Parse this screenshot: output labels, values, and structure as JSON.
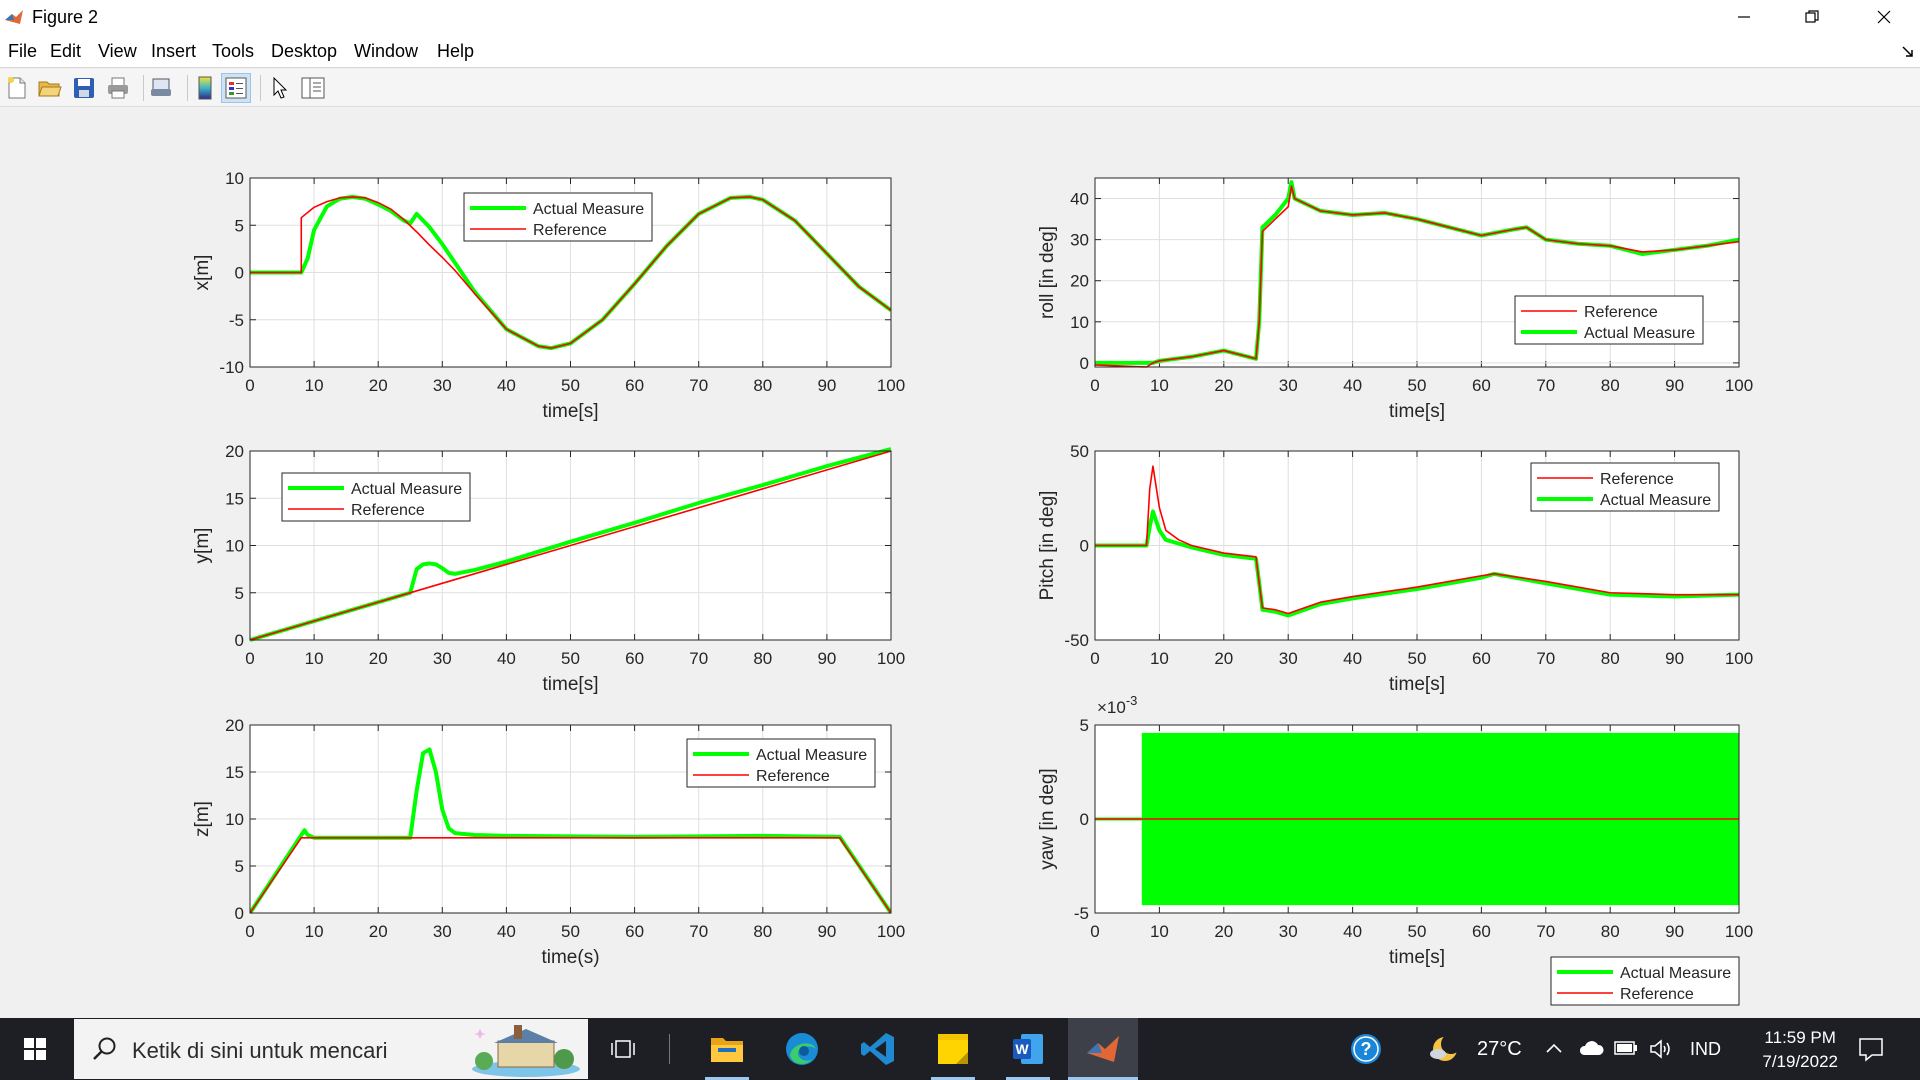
{
  "window": {
    "title": "Figure 2"
  },
  "menu": [
    "File",
    "Edit",
    "View",
    "Insert",
    "Tools",
    "Desktop",
    "Window",
    "Help"
  ],
  "toolbar_icons": [
    "new-figure-icon",
    "open-file-icon",
    "save-icon",
    "print-icon",
    "link-plot-icon",
    "insert-colorbar-icon",
    "insert-legend-icon",
    "edit-plot-icon",
    "property-inspector-icon"
  ],
  "colors": {
    "actual": "#00ff00",
    "reference": "#ff0000",
    "taskbar": "#1d1f24"
  },
  "chart_data": [
    {
      "id": "x",
      "type": "line",
      "xlabel": "time[s]",
      "ylabel": "x[m]",
      "xlim": [
        0,
        100
      ],
      "ylim": [
        -10,
        10
      ],
      "yticks": [
        -10,
        -5,
        0,
        5,
        10
      ],
      "grid": true,
      "legend": {
        "position": "top-center",
        "entries": [
          "Actual Measure",
          "Reference"
        ]
      },
      "series": [
        {
          "name": "Actual Measure",
          "x": [
            0,
            8,
            9,
            10,
            12,
            14,
            16,
            18,
            20,
            22,
            24,
            25,
            26,
            27,
            28,
            30,
            32,
            35,
            40,
            45,
            47,
            50,
            55,
            60,
            65,
            70,
            75,
            78,
            80,
            85,
            90,
            95,
            100
          ],
          "y": [
            0,
            0,
            1.5,
            4.5,
            7,
            7.8,
            8,
            7.8,
            7.2,
            6.5,
            5.5,
            5.2,
            6.2,
            5.5,
            4.8,
            3,
            1,
            -2,
            -6,
            -7.8,
            -8,
            -7.5,
            -5,
            -1.2,
            2.8,
            6.2,
            7.9,
            8,
            7.7,
            5.5,
            2,
            -1.5,
            -4
          ]
        },
        {
          "name": "Reference",
          "x": [
            0,
            8,
            8,
            10,
            12,
            14,
            16,
            18,
            20,
            22,
            24,
            26,
            28,
            30,
            32,
            35,
            40,
            45,
            47,
            50,
            55,
            60,
            65,
            70,
            75,
            78,
            80,
            85,
            90,
            95,
            100
          ],
          "y": [
            0,
            0,
            5.8,
            6.9,
            7.5,
            7.9,
            8,
            7.9,
            7.4,
            6.7,
            5.6,
            4.3,
            2.9,
            1.6,
            0.2,
            -2.2,
            -6,
            -7.8,
            -8,
            -7.5,
            -5,
            -1.2,
            2.8,
            6.2,
            7.9,
            8,
            7.7,
            5.5,
            2,
            -1.5,
            -4
          ]
        }
      ]
    },
    {
      "id": "y",
      "type": "line",
      "xlabel": "time[s]",
      "ylabel": "y[m]",
      "xlim": [
        0,
        100
      ],
      "ylim": [
        0,
        20
      ],
      "yticks": [
        0,
        5,
        10,
        15,
        20
      ],
      "grid": true,
      "legend": {
        "position": "top-left",
        "entries": [
          "Actual Measure",
          "Reference"
        ]
      },
      "series": [
        {
          "name": "Actual Measure",
          "x": [
            0,
            10,
            20,
            25,
            26,
            27,
            28,
            29,
            30,
            31,
            32,
            35,
            40,
            50,
            60,
            70,
            80,
            90,
            100
          ],
          "y": [
            0,
            2,
            4,
            5,
            7.5,
            8,
            8.1,
            8,
            7.6,
            7.1,
            7,
            7.4,
            8.3,
            10.4,
            12.4,
            14.5,
            16.4,
            18.4,
            20.2
          ]
        },
        {
          "name": "Reference",
          "x": [
            0,
            100
          ],
          "y": [
            0,
            20
          ]
        }
      ]
    },
    {
      "id": "z",
      "type": "line",
      "xlabel": "time(s)",
      "ylabel": "z[m]",
      "xlim": [
        0,
        100
      ],
      "ylim": [
        0,
        20
      ],
      "yticks": [
        0,
        5,
        10,
        15,
        20
      ],
      "grid": true,
      "legend": {
        "position": "top-right",
        "entries": [
          "Actual Measure",
          "Reference"
        ]
      },
      "series": [
        {
          "name": "Actual Measure",
          "x": [
            0,
            8.5,
            9,
            10,
            25,
            26,
            27,
            28,
            29,
            30,
            31,
            32,
            35,
            40,
            60,
            80,
            92,
            100
          ],
          "y": [
            0,
            8.8,
            8.3,
            8,
            8,
            13,
            17,
            17.4,
            15,
            11,
            9,
            8.5,
            8.3,
            8.2,
            8.1,
            8.2,
            8.1,
            0
          ]
        },
        {
          "name": "Reference",
          "x": [
            0,
            8,
            92,
            100
          ],
          "y": [
            0,
            8,
            8,
            0
          ]
        }
      ]
    },
    {
      "id": "roll",
      "type": "line",
      "xlabel": "time[s]",
      "ylabel": "roll [in deg]",
      "xlim": [
        0,
        100
      ],
      "ylim": [
        -1,
        45
      ],
      "yticks": [
        0,
        10,
        20,
        30,
        40
      ],
      "grid": true,
      "legend": {
        "position": "bottom-right",
        "entries": [
          "Reference",
          "Actual Measure"
        ]
      },
      "series": [
        {
          "name": "Reference",
          "x": [
            0,
            8,
            9,
            10,
            15,
            20,
            25,
            25.5,
            26,
            28,
            30,
            30.5,
            31,
            35,
            40,
            45,
            50,
            55,
            60,
            65,
            67,
            70,
            75,
            80,
            85,
            90,
            95,
            100
          ],
          "y": [
            -0.5,
            -1,
            0,
            0.5,
            1.5,
            3,
            1,
            10,
            32,
            35,
            38,
            43,
            40,
            37,
            36,
            36.5,
            35,
            33,
            31,
            32.5,
            33,
            30,
            29,
            28.5,
            27,
            27.5,
            28.5,
            29.5
          ]
        },
        {
          "name": "Actual Measure",
          "x": [
            0,
            8,
            9,
            10,
            15,
            20,
            25,
            25.5,
            26,
            28,
            30,
            30.5,
            31,
            35,
            40,
            45,
            50,
            55,
            60,
            65,
            67,
            70,
            75,
            80,
            85,
            90,
            95,
            100
          ],
          "y": [
            0,
            0,
            0,
            0.5,
            1.5,
            3,
            1,
            10,
            33,
            36,
            40,
            44,
            40,
            37,
            36,
            36.5,
            35,
            33,
            31,
            32.5,
            33,
            30,
            29,
            28.5,
            26.5,
            27.5,
            28.5,
            30
          ]
        }
      ]
    },
    {
      "id": "pitch",
      "type": "line",
      "xlabel": "time[s]",
      "ylabel": "Pitch [in deg]",
      "xlim": [
        0,
        100
      ],
      "ylim": [
        -50,
        50
      ],
      "yticks": [
        -50,
        0,
        50
      ],
      "grid": true,
      "legend": {
        "position": "top-right",
        "entries": [
          "Reference",
          "Actual Measure"
        ]
      },
      "series": [
        {
          "name": "Reference",
          "x": [
            0,
            8,
            8.5,
            9,
            10,
            11,
            13,
            15,
            20,
            25,
            25.5,
            26,
            28,
            30,
            35,
            40,
            50,
            60,
            62,
            70,
            80,
            90,
            100
          ],
          "y": [
            0,
            0,
            30,
            42,
            20,
            8,
            3,
            0,
            -4,
            -6,
            -20,
            -33,
            -34,
            -36,
            -30,
            -27,
            -22,
            -16,
            -15,
            -19,
            -25,
            -26,
            -26
          ]
        },
        {
          "name": "Actual Measure",
          "x": [
            0,
            8,
            8.5,
            9,
            10,
            11,
            13,
            15,
            20,
            25,
            25.5,
            26,
            28,
            30,
            35,
            40,
            50,
            60,
            62,
            70,
            80,
            90,
            100
          ],
          "y": [
            0,
            0,
            10,
            18,
            8,
            3,
            1,
            -1,
            -5,
            -7,
            -20,
            -34,
            -35,
            -37,
            -31,
            -28,
            -23,
            -17,
            -15,
            -20,
            -26,
            -27,
            -26
          ]
        }
      ]
    },
    {
      "id": "yaw",
      "type": "area",
      "xlabel": "time[s]",
      "ylabel": "yaw [in deg]",
      "xlim": [
        0,
        100
      ],
      "ylim": [
        -5,
        5
      ],
      "yticks": [
        -5,
        0,
        5
      ],
      "yexponent": "×10^-3",
      "grid": true,
      "legend": {
        "position": "below-right",
        "entries": [
          "Actual Measure",
          "Reference"
        ]
      },
      "series": [
        {
          "name": "Actual Measure",
          "x": [
            0,
            7.5,
            7.5,
            100
          ],
          "y_upper": [
            0,
            0,
            4.5,
            4.5
          ],
          "y_lower": [
            0,
            0,
            -4.5,
            -4.5
          ]
        },
        {
          "name": "Reference",
          "x": [
            0,
            100
          ],
          "y": [
            0,
            0
          ]
        }
      ]
    }
  ],
  "taskbar": {
    "search_placeholder": "Ketik di sini untuk mencari",
    "apps": [
      "task-view-icon",
      "file-explorer-icon",
      "edge-icon",
      "vscode-icon",
      "sticky-notes-icon",
      "word-icon",
      "matlab-icon"
    ],
    "weather": "27°C",
    "language": "IND",
    "time": "11:59 PM",
    "date": "7/19/2022"
  }
}
